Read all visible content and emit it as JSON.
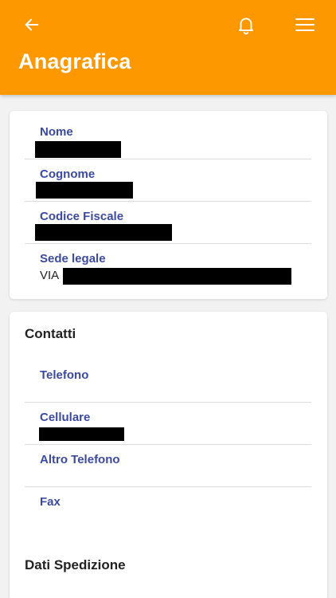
{
  "header": {
    "title": "Anagrafica",
    "back_icon": "arrow-left-icon",
    "bell_icon": "bell-icon",
    "menu_icon": "hamburger-menu-icon",
    "color": "#fe9800"
  },
  "anagrafica": {
    "nome_label": "Nome",
    "cognome_label": "Cognome",
    "codice_fiscale_label": "Codice Fiscale",
    "sede_legale_label": "Sede legale",
    "sede_legale_prefix": "VIA"
  },
  "contatti": {
    "title": "Contatti",
    "telefono_label": "Telefono",
    "cellulare_label": "Cellulare",
    "altro_telefono_label": "Altro Telefono",
    "fax_label": "Fax"
  },
  "spedizione": {
    "title": "Dati Spedizione"
  },
  "label_color": "#3b4aa0"
}
